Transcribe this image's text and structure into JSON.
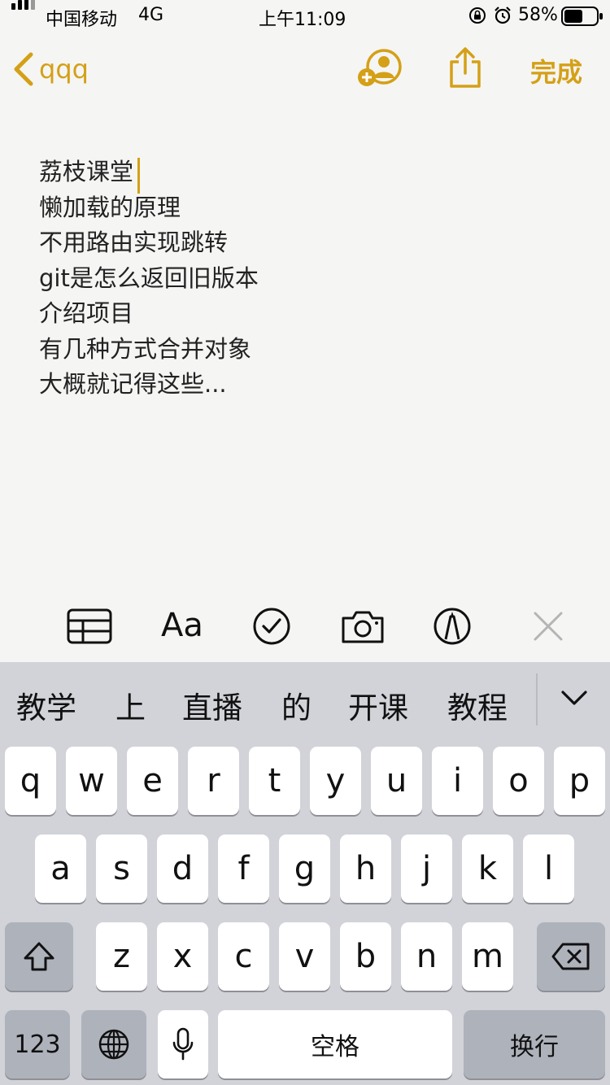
{
  "status_bar": {
    "carrier": "中国移动",
    "network": "4G",
    "time": "上午11:09",
    "battery_percent": "58%",
    "battery_level": 0.58
  },
  "nav": {
    "back_label": "qqq",
    "done_label": "完成"
  },
  "note": {
    "lines": [
      "荔枝课堂",
      "懒加载的原理",
      "不用路由实现跳转",
      "git是怎么返回旧版本",
      "介绍项目",
      "有几种方式合并对象",
      "大概就记得这些..."
    ]
  },
  "format_toolbar": {
    "text_style_label": "Aa",
    "icons": [
      "table-icon",
      "text-style-icon",
      "checklist-icon",
      "camera-icon",
      "markup-icon",
      "close-icon"
    ]
  },
  "keyboard": {
    "candidates": [
      "教学",
      "上",
      "直播",
      "的",
      "开课",
      "教程"
    ],
    "row1": [
      "q",
      "w",
      "e",
      "r",
      "t",
      "y",
      "u",
      "i",
      "o",
      "p"
    ],
    "row2": [
      "a",
      "s",
      "d",
      "f",
      "g",
      "h",
      "j",
      "k",
      "l"
    ],
    "row3": [
      "z",
      "x",
      "c",
      "v",
      "b",
      "n",
      "m"
    ],
    "numbers_label": "123",
    "space_label": "空格",
    "return_label": "换行"
  },
  "colors": {
    "accent": "#d4a017",
    "keyboard_bg": "#d1d3d9",
    "key_dark": "#aeb2bb"
  }
}
